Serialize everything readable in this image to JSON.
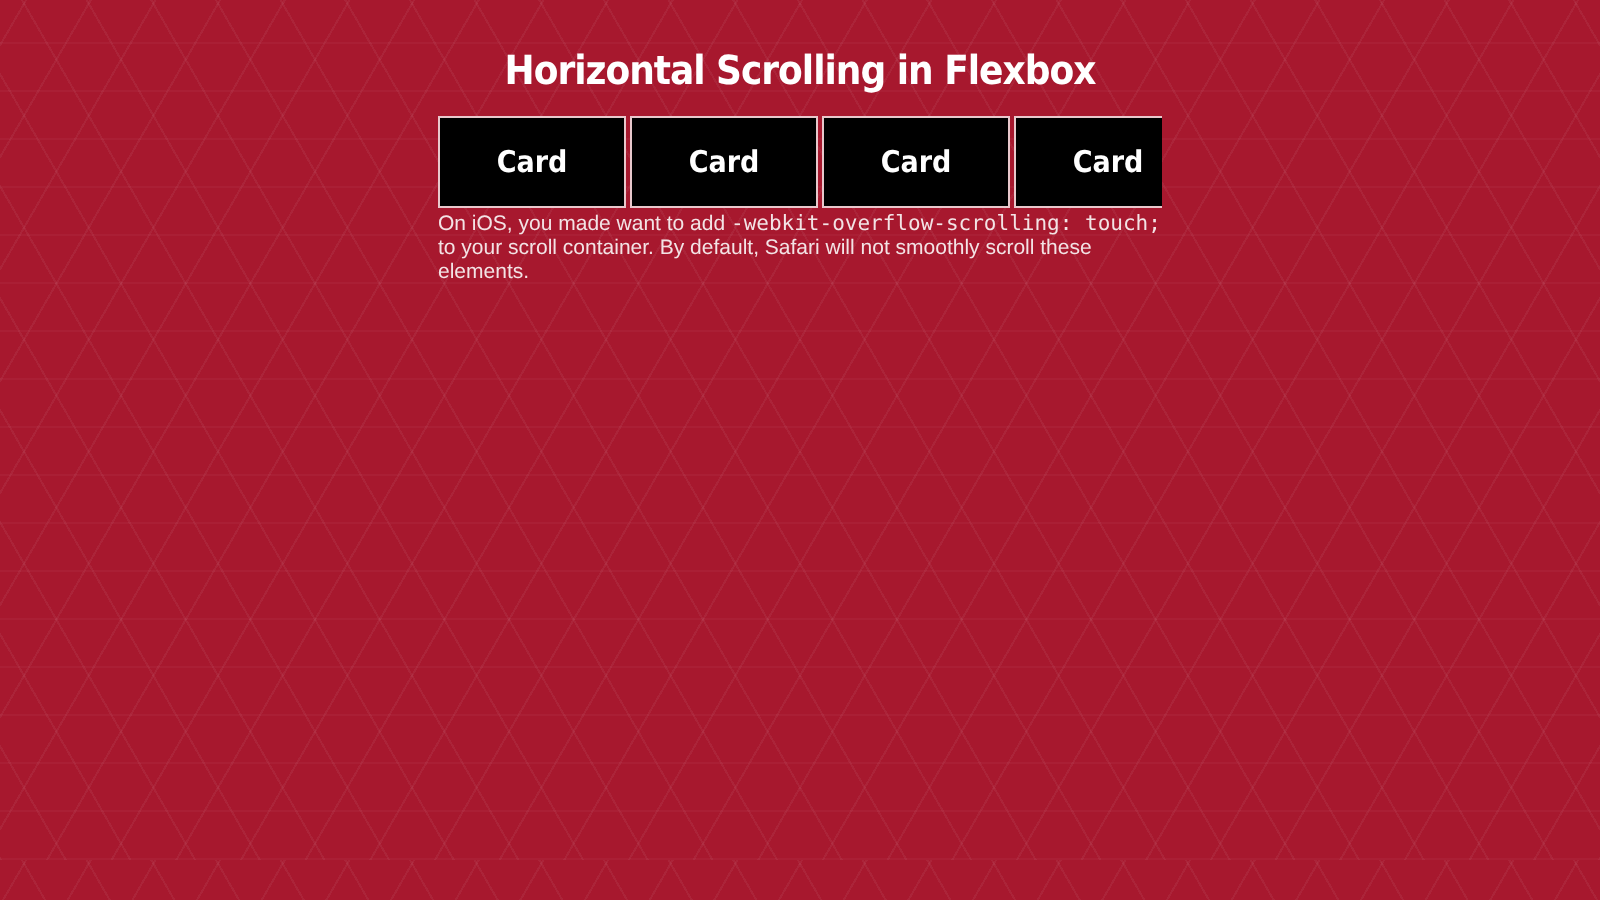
{
  "title": "Horizontal Scrolling in Flexbox",
  "cards": [
    {
      "label": "Card"
    },
    {
      "label": "Card"
    },
    {
      "label": "Card"
    },
    {
      "label": "Card"
    }
  ],
  "note": {
    "before": "On iOS, you made want to add ",
    "code": "-webkit-overflow-scrolling: touch;",
    "after": " to your scroll container. By default, Safari will not smoothly scroll these elements."
  }
}
